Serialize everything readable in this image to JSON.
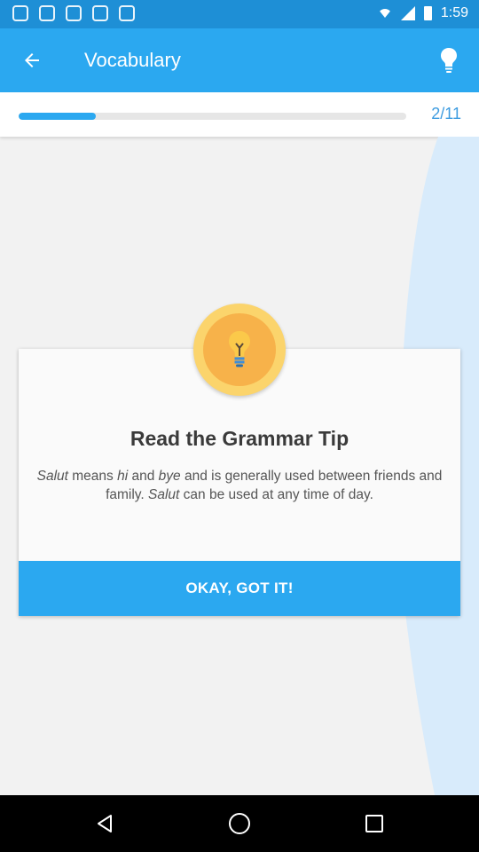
{
  "status_bar": {
    "time": "1:59",
    "left_icons": [
      "app-notification-icon",
      "app-notification-icon",
      "app-notification-icon",
      "app-notification-icon",
      "app-notification-icon"
    ],
    "right_icons": [
      "wifi-icon",
      "signal-icon",
      "battery-icon"
    ]
  },
  "app_bar": {
    "title": "Vocabulary",
    "back_icon": "arrow-back-icon",
    "tip_icon": "lightbulb-icon",
    "color": "#2ba8f0"
  },
  "progress": {
    "label": "2/11",
    "fraction": 0.2
  },
  "tip_card": {
    "badge_icon": "lightbulb-icon",
    "title": "Read the Grammar Tip",
    "body": {
      "part1": "Salut",
      "part2": " means ",
      "part3": "hi",
      "part4": " and ",
      "part5": "bye",
      "part6": " and is generally used between friends and family. ",
      "part7": "Salut",
      "part8": " can be used at any time of day."
    },
    "button_label": "OKAY, GOT IT!"
  },
  "nav_bar": {
    "items": [
      "back-triangle-icon",
      "home-circle-icon",
      "recents-square-icon"
    ]
  }
}
